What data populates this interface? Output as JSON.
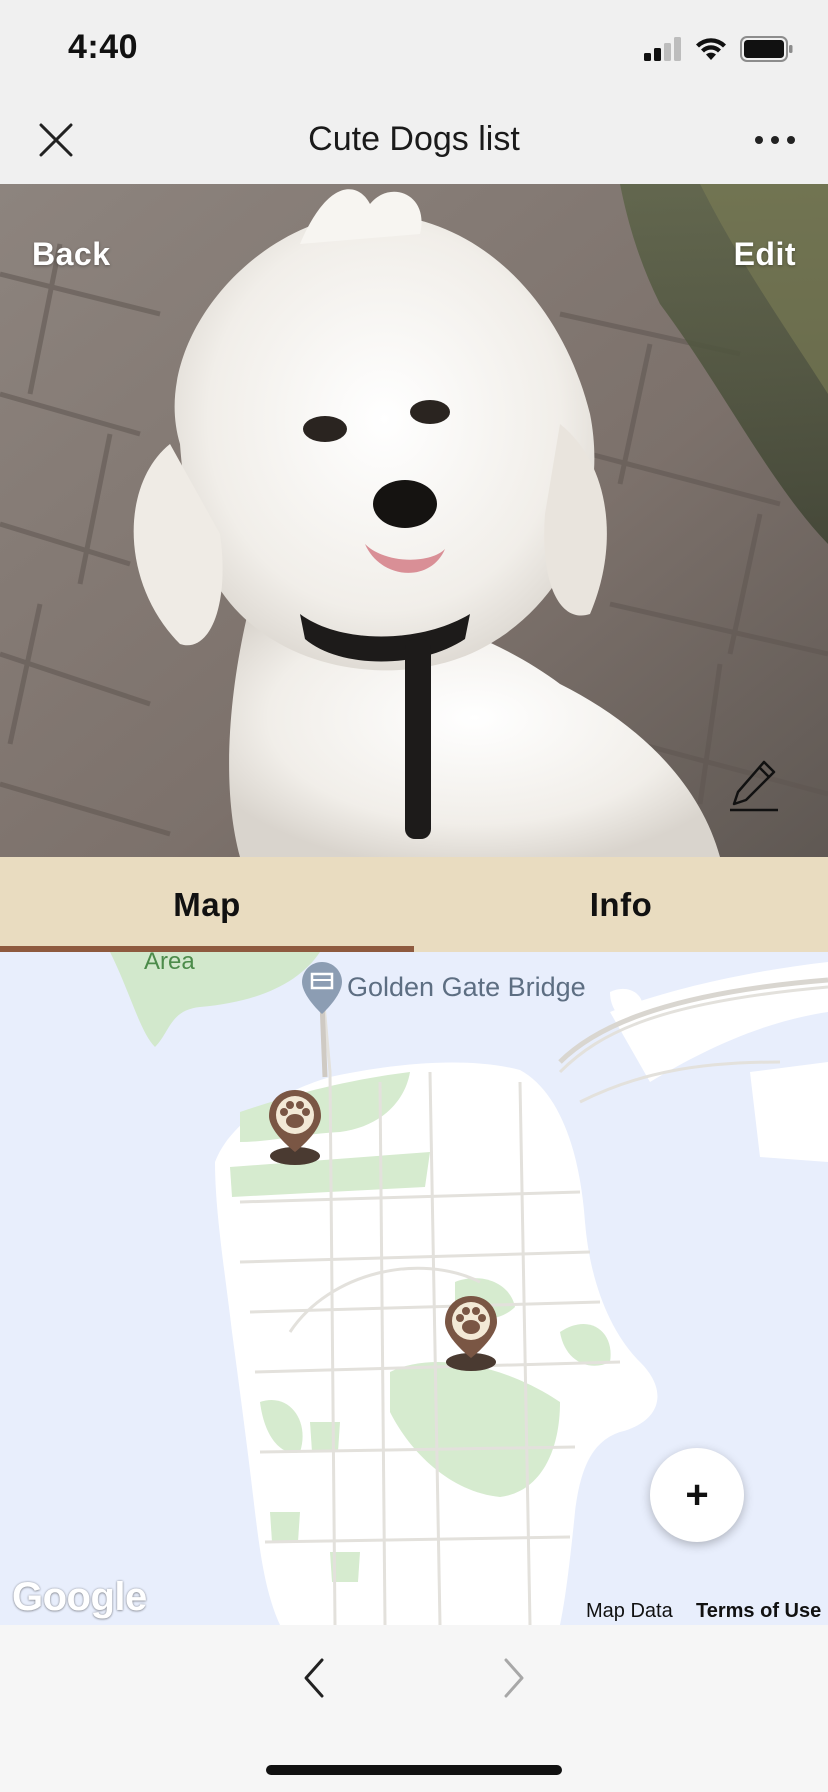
{
  "status_bar": {
    "time": "4:40"
  },
  "nav": {
    "title": "Cute Dogs list",
    "close_icon": "close-icon",
    "more_icon": "more-horizontal-icon"
  },
  "hero": {
    "back_label": "Back",
    "edit_label": "Edit",
    "pencil_icon": "pencil-icon"
  },
  "tabs": [
    {
      "label": "Map",
      "selected": true
    },
    {
      "label": "Info",
      "selected": false
    }
  ],
  "map": {
    "area_label": "Area",
    "landmark_label": "Golden Gate Bridge",
    "add_label": "+",
    "attribution_logo": "Google",
    "map_data_label": "Map Data",
    "terms_label": "Terms of Use",
    "marker_icon": "paw-marker-icon"
  },
  "colors": {
    "tab_bar": "#e9dcc0",
    "tab_accent": "#8e5a3f",
    "marker": "#7a5644",
    "water": "#e8eefc",
    "park": "#d6ebcf"
  }
}
